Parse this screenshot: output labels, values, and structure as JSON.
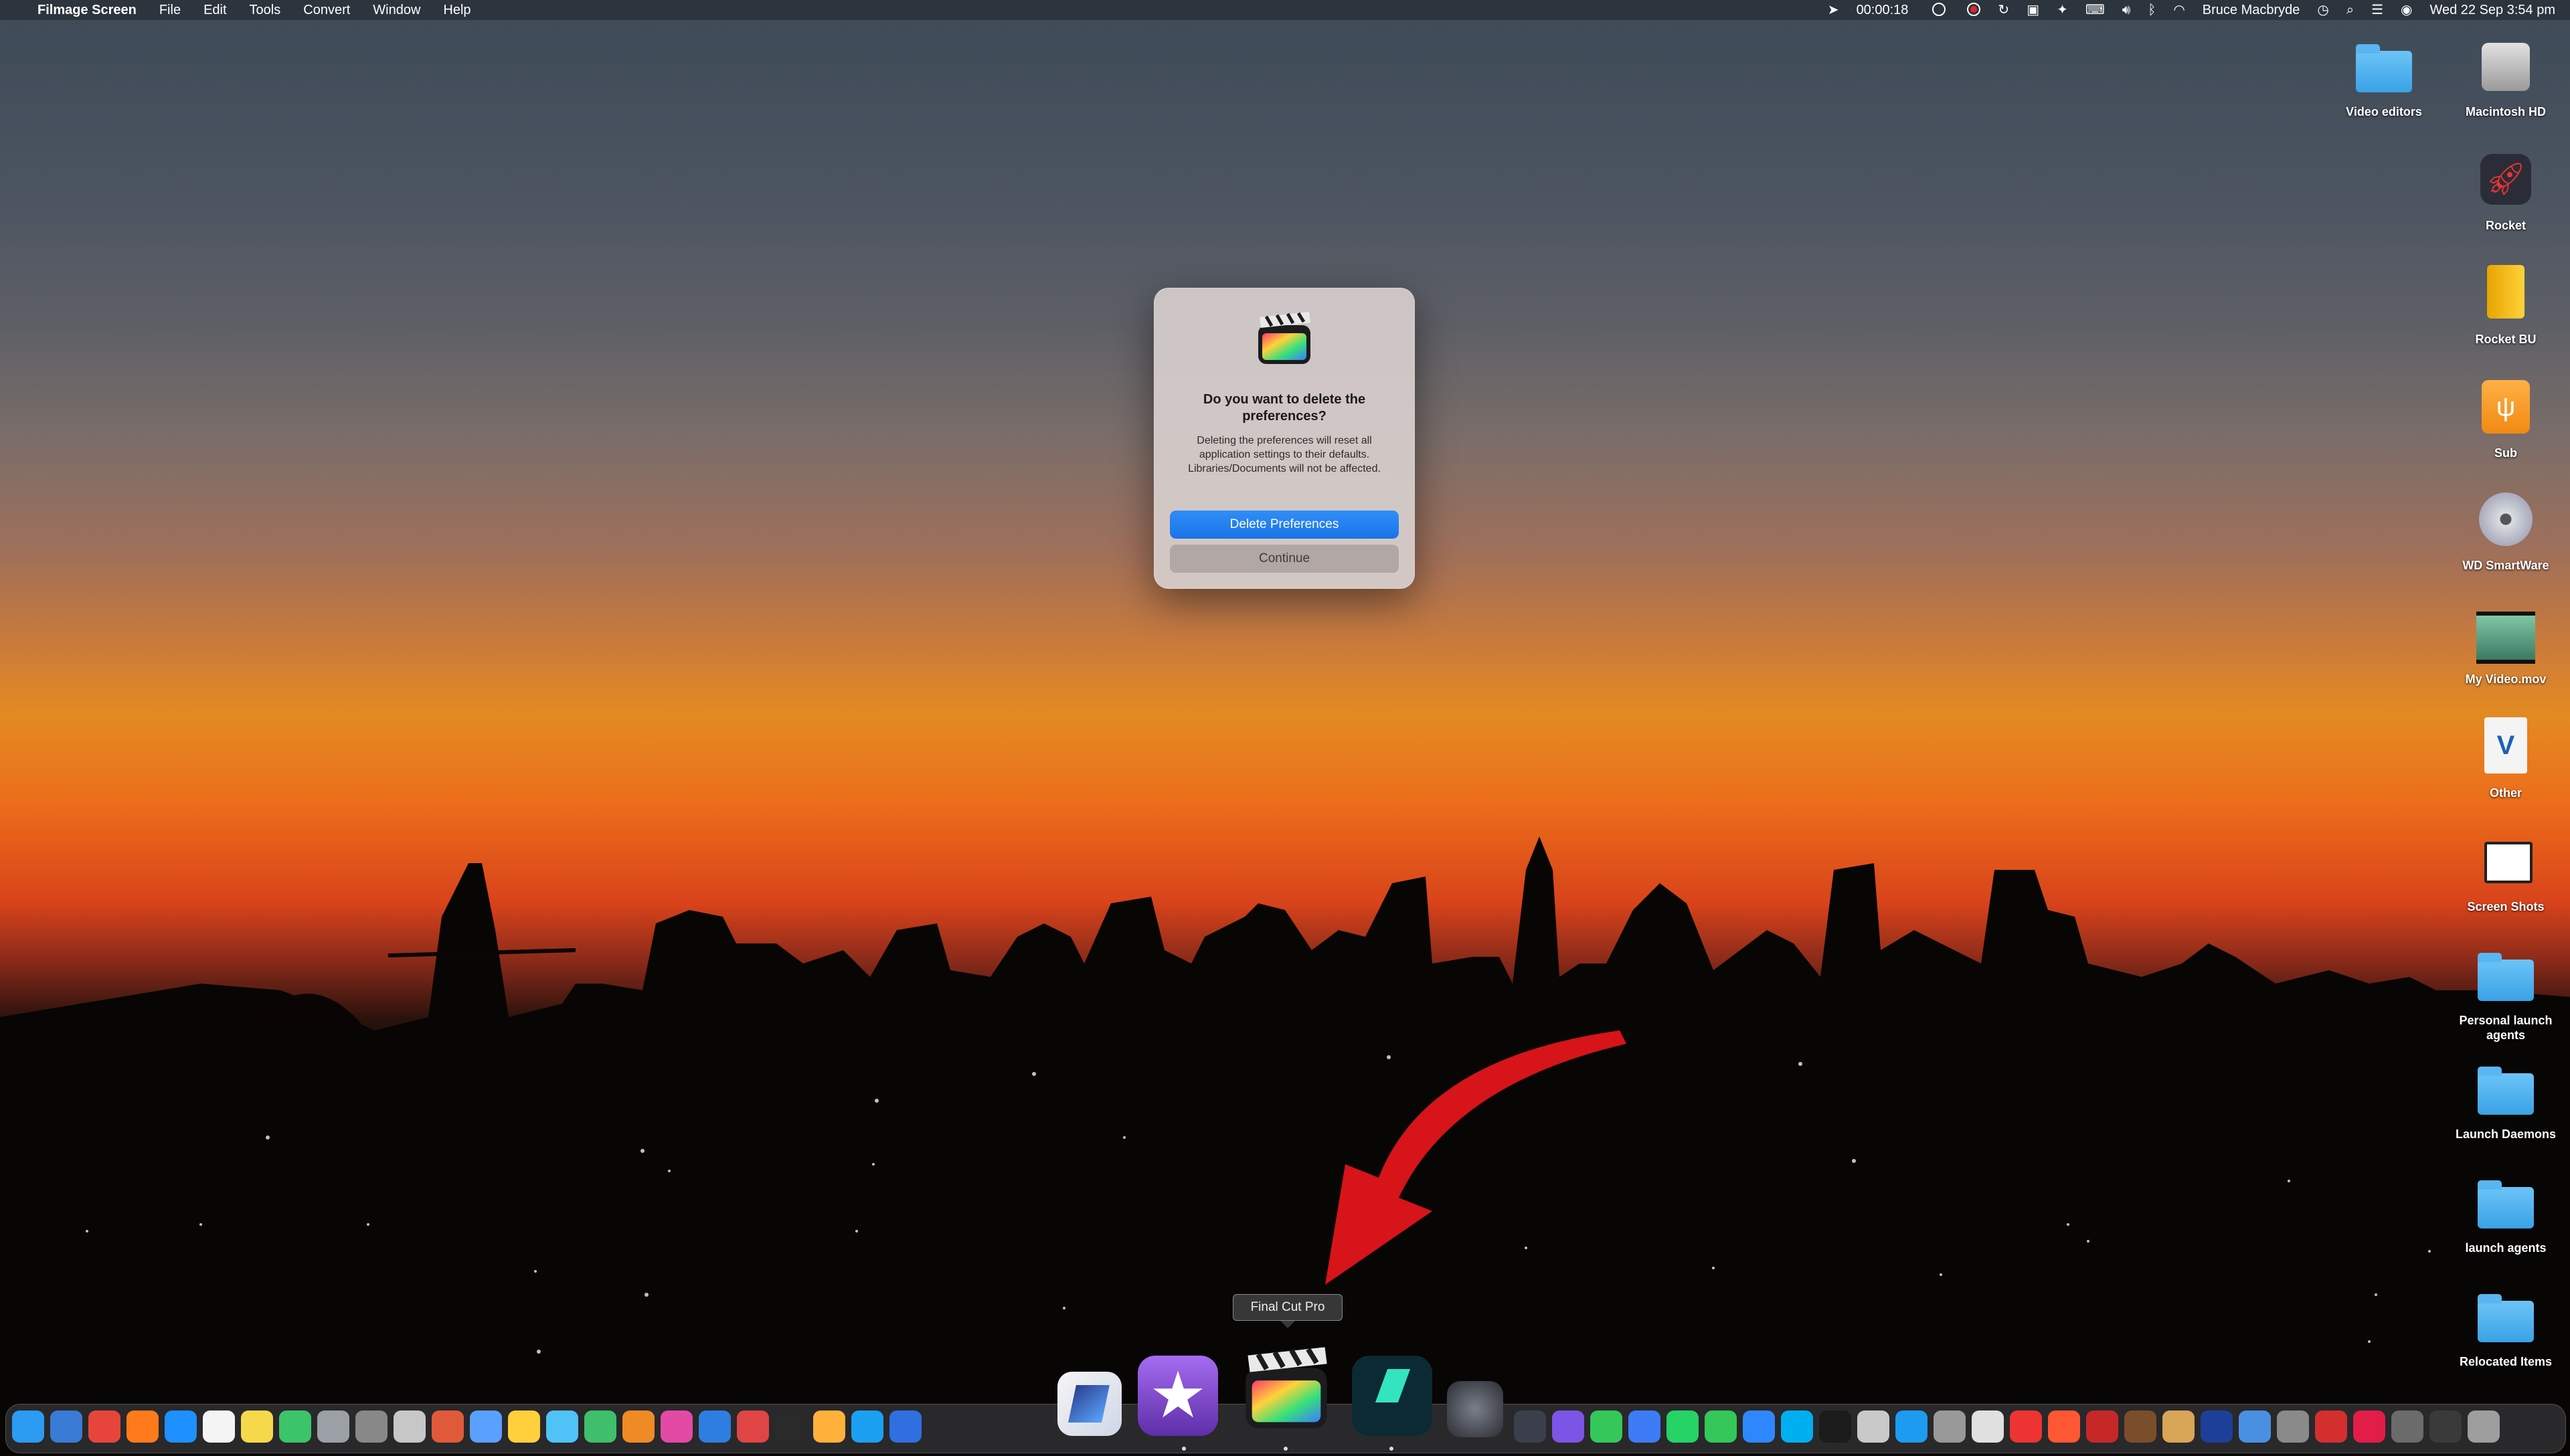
{
  "menubar": {
    "app_name": "Filmage Screen",
    "menus": [
      "File",
      "Edit",
      "Tools",
      "Convert",
      "Window",
      "Help"
    ],
    "timer": "00:00:18",
    "user": "Bruce Macbryde",
    "datetime": "Wed 22 Sep  3:54 pm"
  },
  "dialog": {
    "title": "Do you want to delete the preferences?",
    "message": "Deleting the preferences will reset all application settings to their defaults. Libraries/Documents will not be affected.",
    "primary_button": "Delete Preferences",
    "secondary_button": "Continue"
  },
  "desktop_items": [
    {
      "label": "Video editors",
      "icon": "folder-icon"
    },
    {
      "label": "Macintosh HD",
      "icon": "hard-drive-icon"
    },
    {
      "label": "Rocket",
      "icon": "rocket-icon"
    },
    {
      "label": "Rocket BU",
      "icon": "external-drive-icon"
    },
    {
      "label": "Sub",
      "icon": "usb-drive-icon"
    },
    {
      "label": "WD SmartWare",
      "icon": "disc-icon"
    },
    {
      "label": "My Video.mov",
      "icon": "video-file-icon"
    },
    {
      "label": "Other",
      "icon": "drive-icon"
    },
    {
      "label": "Screen Shots",
      "icon": "screenshot-folder-icon"
    },
    {
      "label": "Personal launch agents",
      "icon": "folder-icon"
    },
    {
      "label": "Launch Daemons",
      "icon": "folder-icon"
    },
    {
      "label": "launch agents",
      "icon": "folder-icon"
    },
    {
      "label": "Relocated Items",
      "icon": "folder-icon"
    }
  ],
  "tooltip": "Final Cut Pro",
  "dock": {
    "magnified": [
      "Filmage",
      "iMovie",
      "Final Cut Pro",
      "Filmora",
      "Motion"
    ],
    "accent": "#1a73e8"
  }
}
